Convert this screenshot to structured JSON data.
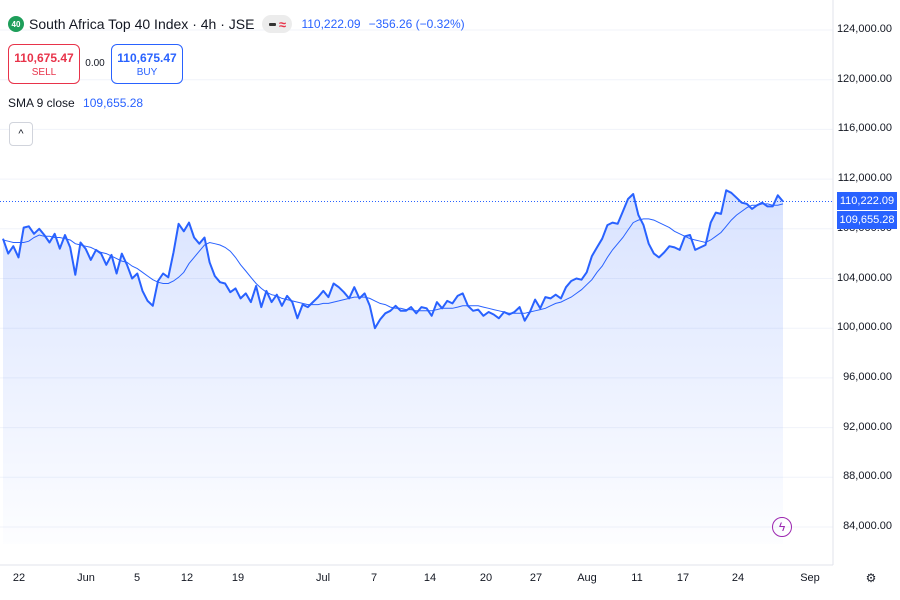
{
  "header": {
    "symbol_badge": "40",
    "title": "South Africa Top 40 Index · 4h · JSE",
    "last_price": "110,222.09",
    "change": "−356.26 (−0.32%)"
  },
  "trade": {
    "sell_price": "110,675.47",
    "sell_label": "SELL",
    "spread": "0.00",
    "buy_price": "110,675.47",
    "buy_label": "BUY"
  },
  "indicator": {
    "label": "SMA 9 close",
    "value": "109,655.28"
  },
  "price_tags": {
    "last": "110,222.09",
    "sma": "109,655.28"
  },
  "colors": {
    "accent": "#2962ff",
    "sell": "#e8334a",
    "badge": "#1e9e5a",
    "flash": "#9c27b0"
  },
  "icons": {
    "collapse": "chevron-up-icon",
    "flash": "lightning-icon",
    "settings": "gear-icon"
  },
  "chart_data": {
    "type": "area",
    "y_ticks": [
      "124,000.00",
      "120,000.00",
      "116,000.00",
      "112,000.00",
      "108,000.00",
      "104,000.00",
      "100,000.00",
      "96,000.00",
      "92,000.00",
      "88,000.00",
      "84,000.00"
    ],
    "x_ticks": [
      "22",
      "Jun",
      "5",
      "12",
      "19",
      "Jul",
      "7",
      "14",
      "20",
      "27",
      "Aug",
      "11",
      "17",
      "24",
      "Sep"
    ],
    "ylim": [
      84000,
      124000
    ],
    "series": [
      {
        "values": [
          107200,
          106000,
          106600,
          105700,
          108100,
          108200,
          107600,
          108000,
          107500,
          106900,
          107600,
          106400,
          107500,
          106500,
          104300,
          106900,
          106400,
          105500,
          106300,
          106000,
          105100,
          105900,
          104400,
          106000,
          105100,
          104000,
          104400,
          103000,
          102200,
          101800,
          103800,
          104400,
          104100,
          106100,
          108400,
          107800,
          108500,
          107300,
          106800,
          107300,
          105300,
          104200,
          103700,
          103600,
          102900,
          103200,
          102400,
          102800,
          102100,
          103400,
          101700,
          103000,
          102100,
          102700,
          101800,
          102600,
          102100,
          100800,
          101900,
          101700,
          102100,
          102500,
          103000,
          102500,
          103600,
          103300,
          102900,
          102400,
          103300,
          102400,
          102800,
          101800,
          100000,
          100700,
          101200,
          101400,
          101800,
          101400,
          101400,
          101700,
          101200,
          101700,
          101600,
          101000,
          102100,
          101600,
          102200,
          102000,
          102600,
          102800,
          101800,
          101400,
          101500,
          101000,
          101300,
          101100,
          100800,
          101300,
          101100,
          101300,
          101700,
          100600,
          101300,
          102300,
          101600,
          102500,
          102400,
          102700,
          102400,
          103300,
          103800,
          104000,
          103900,
          104500,
          105800,
          106500,
          107200,
          108300,
          108500,
          108400,
          109400,
          110400,
          110800,
          109100,
          108300,
          106800,
          106000,
          105700,
          106100,
          106600,
          106500,
          106300,
          107400,
          107500,
          106300,
          106500,
          106700,
          108500,
          109300,
          109200,
          111100,
          110900,
          110500,
          110100,
          110000,
          109600,
          109900,
          110100,
          109800,
          109800,
          110700,
          110200
        ]
      },
      {
        "name": "SMA 9 close",
        "values": [
          107100,
          107000,
          106900,
          106900,
          106900,
          107000,
          107300,
          107500,
          107400,
          107400,
          107300,
          107300,
          107200,
          107100,
          106800,
          106700,
          106600,
          106500,
          106300,
          106100,
          106000,
          105800,
          105600,
          105400,
          105300,
          105000,
          104800,
          104500,
          104200,
          103900,
          103700,
          103600,
          103600,
          103800,
          104100,
          104500,
          105200,
          105700,
          106200,
          106700,
          106900,
          106800,
          106700,
          106500,
          106200,
          105700,
          105100,
          104600,
          104100,
          103600,
          103200,
          102900,
          102700,
          102600,
          102400,
          102300,
          102200,
          102100,
          102000,
          101900,
          101900,
          101900,
          102000,
          102000,
          102100,
          102200,
          102300,
          102400,
          102500,
          102500,
          102500,
          102400,
          102200,
          102000,
          101900,
          101700,
          101600,
          101600,
          101500,
          101500,
          101400,
          101400,
          101400,
          101400,
          101500,
          101600,
          101600,
          101600,
          101700,
          101800,
          101800,
          101800,
          101800,
          101700,
          101600,
          101500,
          101400,
          101300,
          101200,
          101200,
          101200,
          101200,
          101300,
          101400,
          101500,
          101600,
          101800,
          102000,
          102100,
          102300,
          102500,
          102800,
          103100,
          103500,
          103900,
          104500,
          105000,
          105700,
          106300,
          106800,
          107300,
          107900,
          108500,
          108700,
          108800,
          108800,
          108700,
          108500,
          108300,
          108100,
          107800,
          107600,
          107400,
          107200,
          107100,
          107000,
          106900,
          107100,
          107400,
          107700,
          108200,
          108700,
          109100,
          109400,
          109700,
          109900,
          109900,
          110000,
          110000,
          109900,
          109900,
          110000
        ]
      }
    ]
  }
}
